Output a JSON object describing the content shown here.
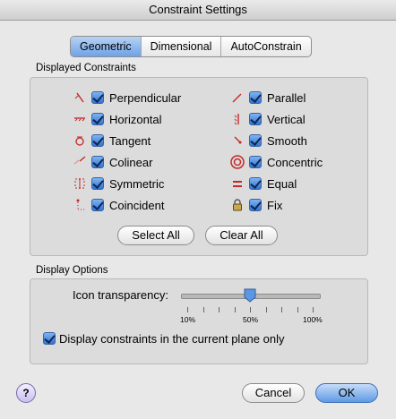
{
  "window": {
    "title": "Constraint Settings"
  },
  "tabs": [
    {
      "label": "Geometric"
    },
    {
      "label": "Dimensional"
    },
    {
      "label": "AutoConstrain"
    }
  ],
  "displayed_constraints": {
    "title": "Displayed Constraints",
    "left": [
      {
        "label": "Perpendicular",
        "icon": "perpendicular-icon",
        "checked": true
      },
      {
        "label": "Horizontal",
        "icon": "horizontal-icon",
        "checked": true
      },
      {
        "label": "Tangent",
        "icon": "tangent-icon",
        "checked": true
      },
      {
        "label": "Colinear",
        "icon": "colinear-icon",
        "checked": true
      },
      {
        "label": "Symmetric",
        "icon": "symmetric-icon",
        "checked": true
      },
      {
        "label": "Coincident",
        "icon": "coincident-icon",
        "checked": true
      }
    ],
    "right": [
      {
        "label": "Parallel",
        "icon": "parallel-icon",
        "checked": true
      },
      {
        "label": "Vertical",
        "icon": "vertical-icon",
        "checked": true
      },
      {
        "label": "Smooth",
        "icon": "smooth-icon",
        "checked": true
      },
      {
        "label": "Concentric",
        "icon": "concentric-icon",
        "checked": true
      },
      {
        "label": "Equal",
        "icon": "equal-icon",
        "checked": true
      },
      {
        "label": "Fix",
        "icon": "lock-icon",
        "checked": true
      }
    ],
    "select_all": "Select All",
    "clear_all": "Clear All"
  },
  "display_options": {
    "title": "Display Options",
    "transparency_label": "Icon transparency:",
    "transparency_value_percent": 50,
    "tick_labels": [
      "10%",
      "50%",
      "100%"
    ],
    "current_plane_label": "Display constraints in the current plane only",
    "current_plane_checked": true
  },
  "footer": {
    "help": "?",
    "cancel": "Cancel",
    "ok": "OK"
  },
  "colors": {
    "icon_red": "#c62828",
    "accent": "#3f7fde"
  }
}
